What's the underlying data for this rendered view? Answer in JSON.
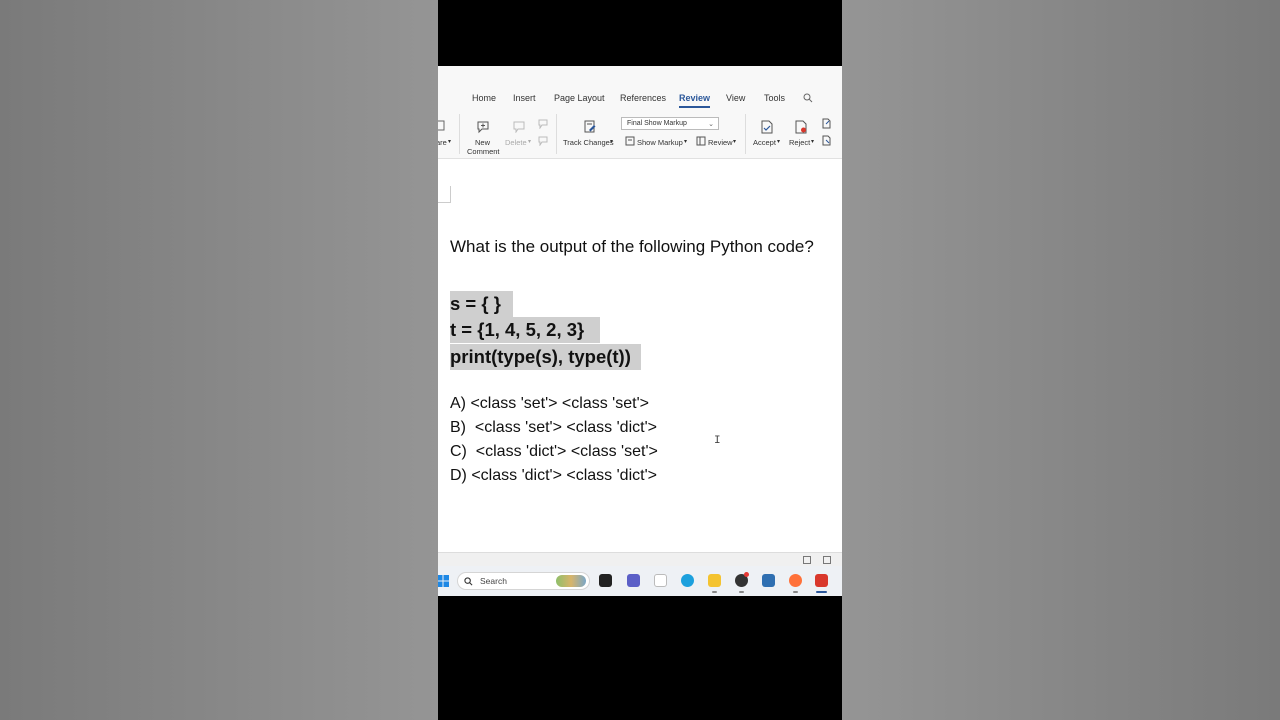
{
  "ribbon_tabs": [
    "Home",
    "Insert",
    "Page Layout",
    "References",
    "Review",
    "View",
    "Tools"
  ],
  "active_tab": "Review",
  "ribbon": {
    "share_fragment": "are",
    "new_comment_line1": "New",
    "new_comment_line2": "Comment",
    "delete_label": "Delete",
    "track_changes_label": "Track Changes",
    "markup_select_value": "Final Show Markup",
    "show_markup_label": "Show Markup",
    "review_label": "Review",
    "accept_label": "Accept",
    "reject_label": "Reject"
  },
  "document": {
    "question": "What is the output of the following Python code?",
    "code_lines": [
      "s = { }",
      "t = {1, 4, 5, 2, 3}",
      "print(type(s), type(t))"
    ],
    "options": [
      "A) <class 'set'> <class 'set'>",
      "B)  <class 'set'> <class 'dict'>",
      "C)  <class 'dict'> <class 'set'>",
      "D) <class 'dict'> <class 'dict'>"
    ]
  },
  "taskbar": {
    "search_label": "Search"
  },
  "colors": {
    "accent": "#2b579a",
    "code_highlight": "#cfcfcf",
    "wps_red": "#d9382c"
  }
}
